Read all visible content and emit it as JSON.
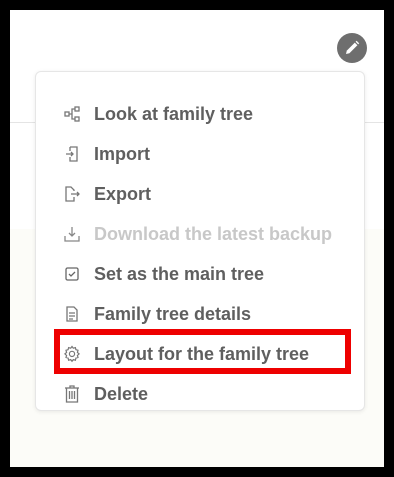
{
  "colors": {
    "label": "#5f5f5f",
    "label_disabled": "#c8c8c8",
    "highlight": "#ee0000",
    "edit_button": "#6e6e6e"
  },
  "edit_button": {
    "icon": "pencil-icon"
  },
  "menu": {
    "items": [
      {
        "label": "Look at family tree",
        "icon": "tree-share-icon",
        "disabled": false
      },
      {
        "label": "Import",
        "icon": "import-icon",
        "disabled": false
      },
      {
        "label": "Export",
        "icon": "export-icon",
        "disabled": false
      },
      {
        "label": "Download the latest backup",
        "icon": "download-icon",
        "disabled": true
      },
      {
        "label": "Set as the main tree",
        "icon": "check-square-icon",
        "disabled": false
      },
      {
        "label": "Family tree details",
        "icon": "document-icon",
        "disabled": false
      },
      {
        "label": "Layout for the family tree",
        "icon": "gear-icon",
        "disabled": false,
        "highlighted": true
      },
      {
        "label": "Delete",
        "icon": "trash-icon",
        "disabled": false
      }
    ]
  }
}
